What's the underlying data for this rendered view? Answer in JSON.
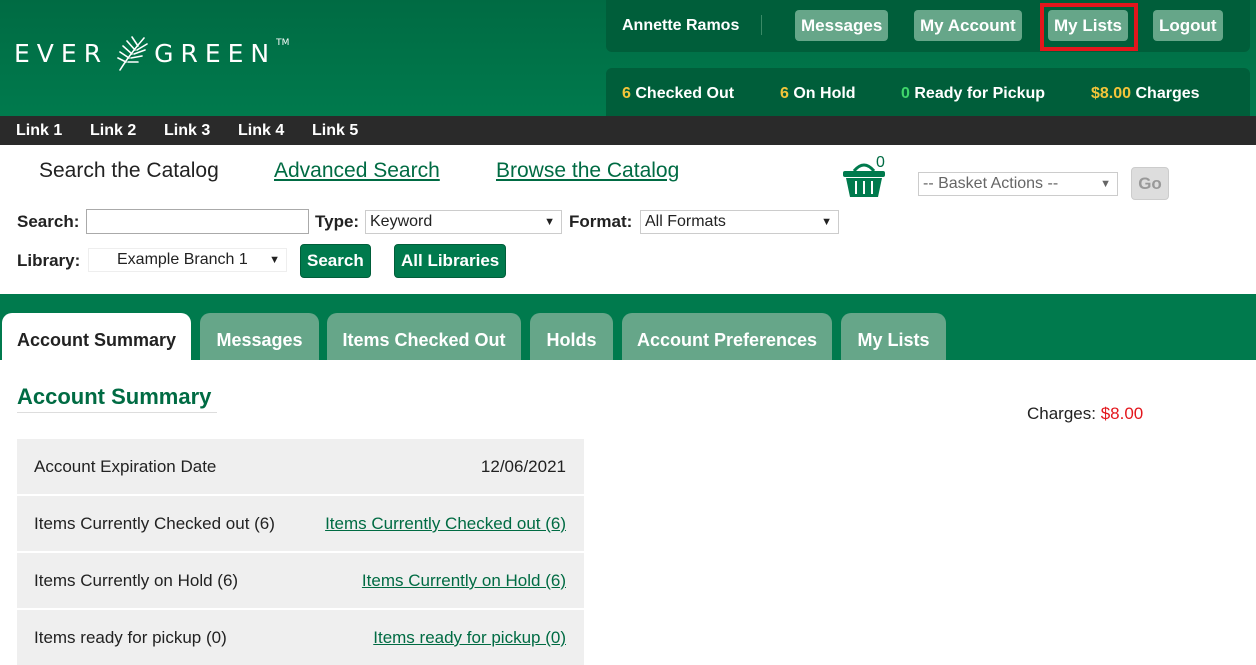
{
  "header": {
    "logo_text_left": "EVER",
    "logo_text_right": "GREEN",
    "logo_tm": "TM",
    "username": "Annette Ramos",
    "buttons": {
      "messages": "Messages",
      "my_account": "My Account",
      "my_lists": "My Lists",
      "logout": "Logout"
    },
    "status": {
      "checked_out_count": "6",
      "checked_out_label": "Checked Out",
      "on_hold_count": "6",
      "on_hold_label": "On Hold",
      "ready_count": "0",
      "ready_label": "Ready for Pickup",
      "charges_amount": "$8.00",
      "charges_label": "Charges"
    }
  },
  "links": [
    "Link 1",
    "Link 2",
    "Link 3",
    "Link 4",
    "Link 5"
  ],
  "search": {
    "title": "Search the Catalog",
    "advanced": "Advanced Search",
    "browse": "Browse the Catalog",
    "basket_count": "0",
    "basket_actions": "-- Basket Actions --",
    "go": "Go",
    "search_label": "Search:",
    "search_value": "",
    "type_label": "Type:",
    "type_value": "Keyword",
    "format_label": "Format:",
    "format_value": "All Formats",
    "library_label": "Library:",
    "library_value": "Example Branch 1",
    "search_button": "Search",
    "all_libraries_button": "All Libraries"
  },
  "tabs": [
    "Account Summary",
    "Messages",
    "Items Checked Out",
    "Holds",
    "Account Preferences",
    "My Lists"
  ],
  "summary": {
    "title": "Account Summary",
    "charges_label": "Charges:",
    "charges_amount": "$8.00",
    "rows": [
      {
        "label": "Account Expiration Date",
        "value": "12/06/2021"
      },
      {
        "label": "Items Currently Checked out (6)",
        "value": "Items Currently Checked out (6)"
      },
      {
        "label": "Items Currently on Hold (6)",
        "value": "Items Currently on Hold (6)"
      },
      {
        "label": "Items ready for pickup (0)",
        "value": "Items ready for pickup (0)"
      }
    ]
  },
  "colors": {
    "brand_green": "#007a4d",
    "highlight_red": "#e3161c",
    "count_yellow": "#f3c53a"
  }
}
